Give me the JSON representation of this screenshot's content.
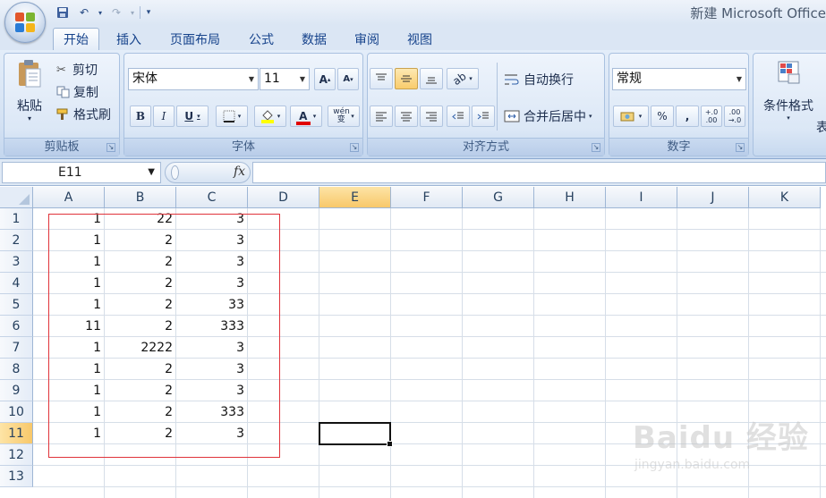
{
  "window": {
    "title": "新建 Microsoft Office"
  },
  "tabs": [
    {
      "label": "开始",
      "active": true
    },
    {
      "label": "插入"
    },
    {
      "label": "页面布局"
    },
    {
      "label": "公式"
    },
    {
      "label": "数据"
    },
    {
      "label": "审阅"
    },
    {
      "label": "视图"
    }
  ],
  "ribbon": {
    "clipboard": {
      "paste": "粘贴",
      "cut": "剪切",
      "copy": "复制",
      "format_painter": "格式刷",
      "label": "剪贴板"
    },
    "font": {
      "name": "宋体",
      "size": "11",
      "grow": "A",
      "shrink": "A",
      "bold": "B",
      "italic": "I",
      "underline": "U",
      "font_color_glyph": "A",
      "phonetic": "wén 变",
      "label": "字体"
    },
    "alignment": {
      "wrap_text": "自动换行",
      "merge_center": "合并后居中",
      "label": "对齐方式"
    },
    "number": {
      "format": "常规",
      "percent": "%",
      "comma": ",",
      "label": "数字",
      "inc_decimal": "+.0 .00",
      "dec_decimal": ".00 →.0"
    },
    "styles": {
      "conditional_format": "条件格式",
      "table_partial": "表"
    }
  },
  "formula_bar": {
    "name_box": "E11",
    "fx": "fx",
    "value": ""
  },
  "columns": [
    "A",
    "B",
    "C",
    "D",
    "E",
    "F",
    "G",
    "H",
    "I",
    "J",
    "K"
  ],
  "selected_column": "E",
  "rows": [
    "1",
    "2",
    "3",
    "4",
    "5",
    "6",
    "7",
    "8",
    "9",
    "10",
    "11",
    "12",
    "13"
  ],
  "selected_row": "11",
  "cells": [
    [
      "1",
      "22",
      "3"
    ],
    [
      "1",
      "2",
      "3"
    ],
    [
      "1",
      "2",
      "3"
    ],
    [
      "1",
      "2",
      "3"
    ],
    [
      "1",
      "2",
      "33"
    ],
    [
      "11",
      "2",
      "333"
    ],
    [
      "1",
      "2222",
      "3"
    ],
    [
      "1",
      "2",
      "3"
    ],
    [
      "1",
      "2",
      "3"
    ],
    [
      "1",
      "2",
      "333"
    ],
    [
      "1",
      "2",
      "3"
    ]
  ],
  "watermark": {
    "main": "Baidu 经验",
    "sub": "jingyan.baidu.com"
  },
  "colors": {
    "accent": "#15428b",
    "selection": "#f8c86a",
    "red_box": "#e0333a"
  }
}
